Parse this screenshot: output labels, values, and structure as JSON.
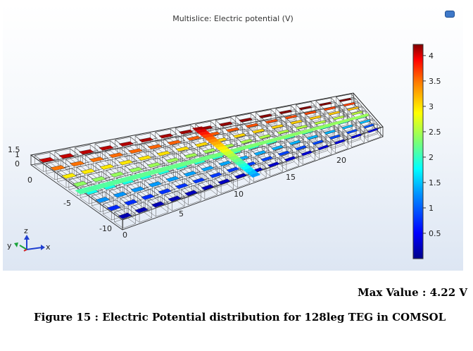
{
  "plot": {
    "title": "Multislice: Electric potential (V)",
    "x_ticks": [
      "0",
      "5",
      "10",
      "15",
      "20"
    ],
    "y_ticks": [
      "0",
      "-5",
      "-10"
    ],
    "z_ticks": [
      "1.5",
      "1",
      "0"
    ],
    "axes_triad": {
      "x": "x",
      "y": "y",
      "z": "z"
    },
    "colormap": "rainbow",
    "colorbar_ticks": [
      "4",
      "3.5",
      "3",
      "2.5",
      "2",
      "1.5",
      "1",
      "0.5"
    ],
    "colorbar_range": [
      0,
      4.22
    ]
  },
  "annotations": {
    "max_value": "Max Value : 4.22  V"
  },
  "caption": "Figure 15 : Electric Potential distribution for 128leg TEG in COMSOL",
  "colors": {
    "background": "#ffffff",
    "frame_stroke": "#222222"
  }
}
